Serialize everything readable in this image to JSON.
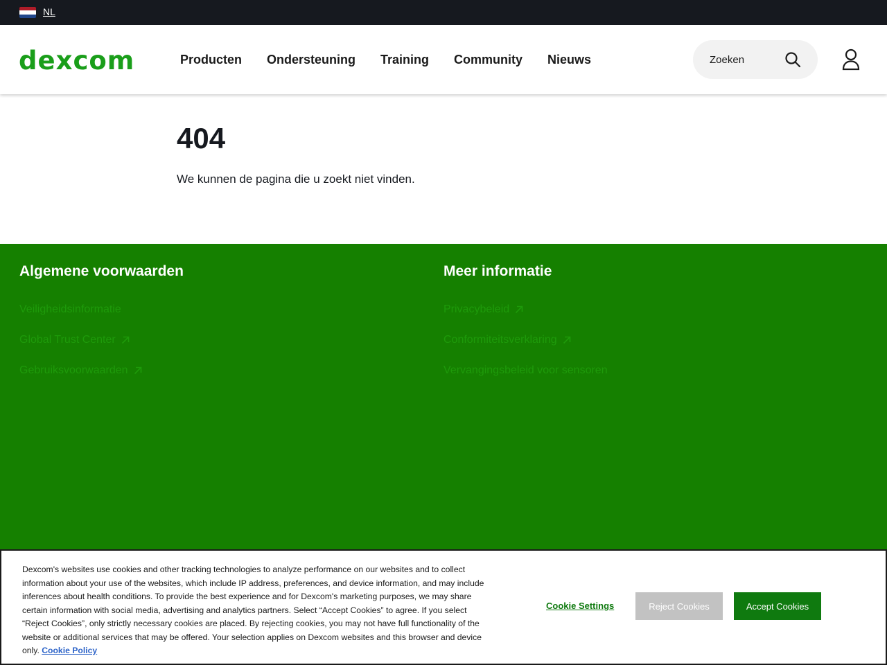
{
  "topbar": {
    "language": "NL",
    "flag_icon": "netherlands-flag-icon"
  },
  "header": {
    "logo": "dexcom",
    "nav": [
      "Producten",
      "Ondersteuning",
      "Training",
      "Community",
      "Nieuws"
    ],
    "search_placeholder": "Zoeken",
    "icons": {
      "search": "search-icon",
      "account": "user-icon"
    }
  },
  "main": {
    "code": "404",
    "message": "We kunnen de pagina die u zoekt niet vinden."
  },
  "footer": {
    "col1": {
      "title": "Algemene voorwaarden",
      "links": [
        "Veiligheidsinformatie",
        "Global Trust Center",
        "Gebruiksvoorwaarden"
      ]
    },
    "col2": {
      "title": "Meer informatie",
      "links": [
        "Privacybeleid",
        "Conformiteitsverklaring",
        "Vervangingsbeleid voor sensoren"
      ]
    }
  },
  "cookie": {
    "text": "Dexcom's websites use cookies and other tracking technologies to analyze performance on our websites and to collect information about your use of the websites, which include IP address, preferences, and device information, and may include inferences about health conditions. To provide the best experience and for Dexcom's marketing purposes, we may share certain information with social media, advertising and analytics partners. Select “Accept Cookies” to agree. If you select “Reject Cookies”, only strictly necessary cookies are placed. By rejecting cookies, you may not have full functionality of the website or additional services that may be offered. Your selection applies on Dexcom websites and this browser and device only.",
    "policy_link": "Cookie Policy",
    "settings_label": "Cookie Settings",
    "reject_label": "Reject Cookies",
    "accept_label": "Accept Cookies"
  },
  "colors": {
    "brand_green": "#158000",
    "logo_green": "#1a9e1a",
    "topbar": "#16191f"
  }
}
